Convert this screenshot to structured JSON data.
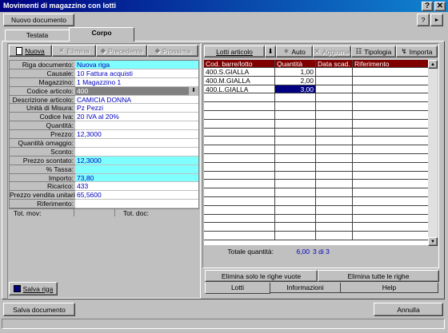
{
  "window": {
    "title": "Movimenti di magazzino con lotti",
    "help_btn": "?",
    "close_btn": "✕"
  },
  "top": {
    "new_doc": "Nuovo documento",
    "help_q": "?",
    "arrow": "►"
  },
  "tabs": {
    "testata": "Testata",
    "corpo": "Corpo"
  },
  "toolbar": {
    "nuova": "Nuova",
    "elimina": "Elimina",
    "precedente": "Precedente",
    "prossima": "Prossima"
  },
  "form": [
    {
      "label": "Riga documento:",
      "value": "Nuova riga",
      "style": "cyan"
    },
    {
      "label": "Causale:",
      "value": "10 Fattura acquisti",
      "style": ""
    },
    {
      "label": "Magazzino:",
      "value": "1 Magazzino 1",
      "style": ""
    },
    {
      "label": "Codice articolo:",
      "value": "400",
      "style": "gray"
    },
    {
      "label": "Descrizione articolo:",
      "value": "CAMICIA DONNA",
      "style": ""
    },
    {
      "label": "Unità di Misura:",
      "value": "Pz Pezzi",
      "style": ""
    },
    {
      "label": "Codice Iva:",
      "value": "20 IVA al 20%",
      "style": ""
    },
    {
      "label": "Quantità:",
      "value": "",
      "style": ""
    },
    {
      "label": "Prezzo:",
      "value": "12,3000",
      "style": ""
    },
    {
      "label": "Quantità omaggio:",
      "value": "",
      "style": ""
    },
    {
      "label": "Sconto:",
      "value": "",
      "style": ""
    },
    {
      "label": "Prezzo scontato:",
      "value": "12,3000",
      "style": "cyan"
    },
    {
      "label": "% Tassa:",
      "value": "",
      "style": "cyan"
    },
    {
      "label": "Importo:",
      "value": "73,80",
      "style": "cyan"
    },
    {
      "label": "Ricarico:",
      "value": "433",
      "style": ""
    },
    {
      "label": "Prezzo vendita unitario:",
      "value": "65,5600",
      "style": ""
    },
    {
      "label": "Riferimento:",
      "value": "",
      "style": ""
    }
  ],
  "totals": {
    "tot_mov": "Tot. mov:",
    "tot_doc": "Tot. doc:"
  },
  "save_row": "Salva riga",
  "lots_toolbar": {
    "lotti": "Lotti articolo",
    "auto": "Auto",
    "aggiorna": "Aggiorna",
    "tipologia": "Tipologia",
    "importa": "Importa"
  },
  "grid": {
    "headers": [
      "Cod. barre/lotto",
      "Quantità",
      "Data scad.",
      "Riferimento"
    ],
    "rows": [
      [
        "400.S.GIALLA",
        "1,00",
        "",
        ""
      ],
      [
        "400.M.GIALLA",
        "2,00",
        "",
        ""
      ],
      [
        "400.L.GIALLA",
        "3,00",
        "",
        ""
      ]
    ]
  },
  "total_qty": {
    "label": "Totale quantità:",
    "value": "6,00",
    "count": "3 di 3"
  },
  "delete_buttons": {
    "empty": "Elimina solo le righe vuote",
    "all": "Elimina tutte le righe"
  },
  "bottom_tabs": {
    "lotti": "Lotti",
    "informazioni": "Informazioni",
    "help": "Help"
  },
  "footer": {
    "save_doc": "Salva documento",
    "cancel": "Annulla"
  }
}
